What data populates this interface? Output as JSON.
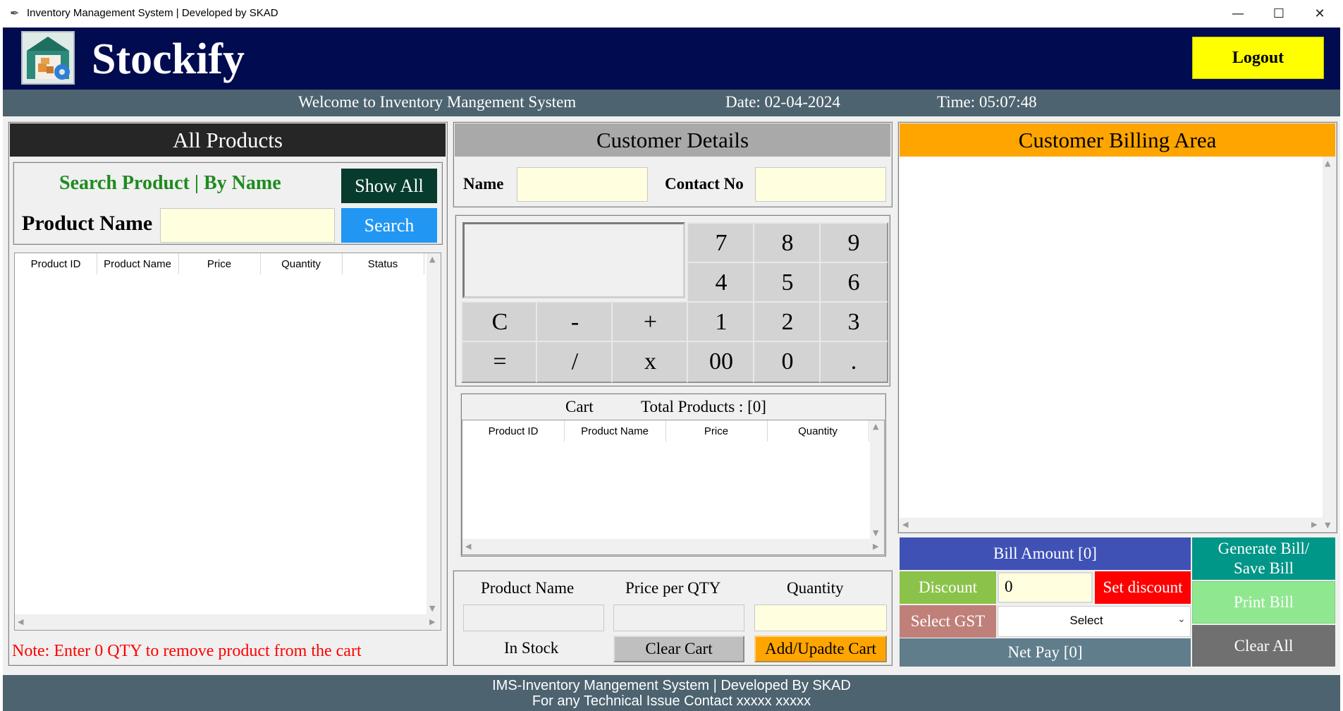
{
  "window": {
    "title": "Inventory Management System | Developed by SKAD",
    "minimize": "—",
    "maximize": "☐",
    "close": "✕"
  },
  "header": {
    "brand": "Stockify",
    "logout_label": "Logout",
    "logo_icon": "warehouse-gear-icon"
  },
  "infobar": {
    "welcome": "Welcome to Inventory Mangement System",
    "date": "Date: 02-04-2024",
    "time": "Time: 05:07:48"
  },
  "products_panel": {
    "title": "All Products",
    "search_heading": "Search Product | By Name",
    "show_all_label": "Show All",
    "product_name_label": "Product Name",
    "product_name_value": "",
    "search_label": "Search",
    "columns": [
      "Product ID",
      "Product Name",
      "Price",
      "Quantity",
      "Status"
    ],
    "note": "Note: Enter 0 QTY to remove product from the cart"
  },
  "customer_panel": {
    "title": "Customer Details",
    "name_label": "Name",
    "name_value": "",
    "contact_label": "Contact No",
    "contact_value": ""
  },
  "calculator": {
    "display_value": "",
    "keys": [
      "7",
      "8",
      "9",
      "4",
      "5",
      "6",
      "C",
      "-",
      "+",
      "1",
      "2",
      "3",
      "=",
      "/",
      "x",
      "00",
      "0",
      "."
    ]
  },
  "cart": {
    "title": "Cart",
    "total_label": "Total Products : [0]",
    "columns": [
      "Product ID",
      "Product Name",
      "Price",
      "Quantity"
    ]
  },
  "cart_entry": {
    "product_name_label": "Product Name",
    "price_label": "Price per QTY",
    "quantity_label": "Quantity",
    "product_name_value": "",
    "price_value": "",
    "quantity_value": "",
    "in_stock_label": "In Stock",
    "clear_cart_label": "Clear Cart",
    "add_update_label": "Add/Upadte Cart"
  },
  "billing": {
    "title": "Customer Billing Area",
    "bill_amount": "Bill Amount [0]",
    "discount_label": "Discount",
    "discount_value": "0",
    "set_discount_label": "Set discount",
    "select_gst_label": "Select GST",
    "gst_selected": "Select",
    "net_pay": "Net Pay [0]",
    "generate_label_1": "Generate Bill/",
    "generate_label_2": "Save Bill",
    "print_label": "Print Bill",
    "clear_all_label": "Clear All"
  },
  "footer": {
    "line1": "IMS-Inventory Mangement System | Developed By SKAD",
    "line2": "For any Technical Issue Contact xxxxx xxxxx"
  },
  "colors": {
    "header_bg": "#010b4f",
    "info_bg": "#4d636f",
    "logout_bg": "#ffff00",
    "show_all_bg": "#063b2d",
    "search_bg": "#2196f3",
    "billing_header_bg": "#ffa500",
    "bill_amount_bg": "#3f51b5",
    "discount_bg": "#8bc34a",
    "set_discount_bg": "#ff0000",
    "gst_bg": "#c0807a",
    "net_pay_bg": "#607d8b",
    "generate_bg": "#009688",
    "print_bg": "#8fe88f",
    "clear_all_bg": "#707070",
    "add_cart_bg": "#ffa500"
  }
}
